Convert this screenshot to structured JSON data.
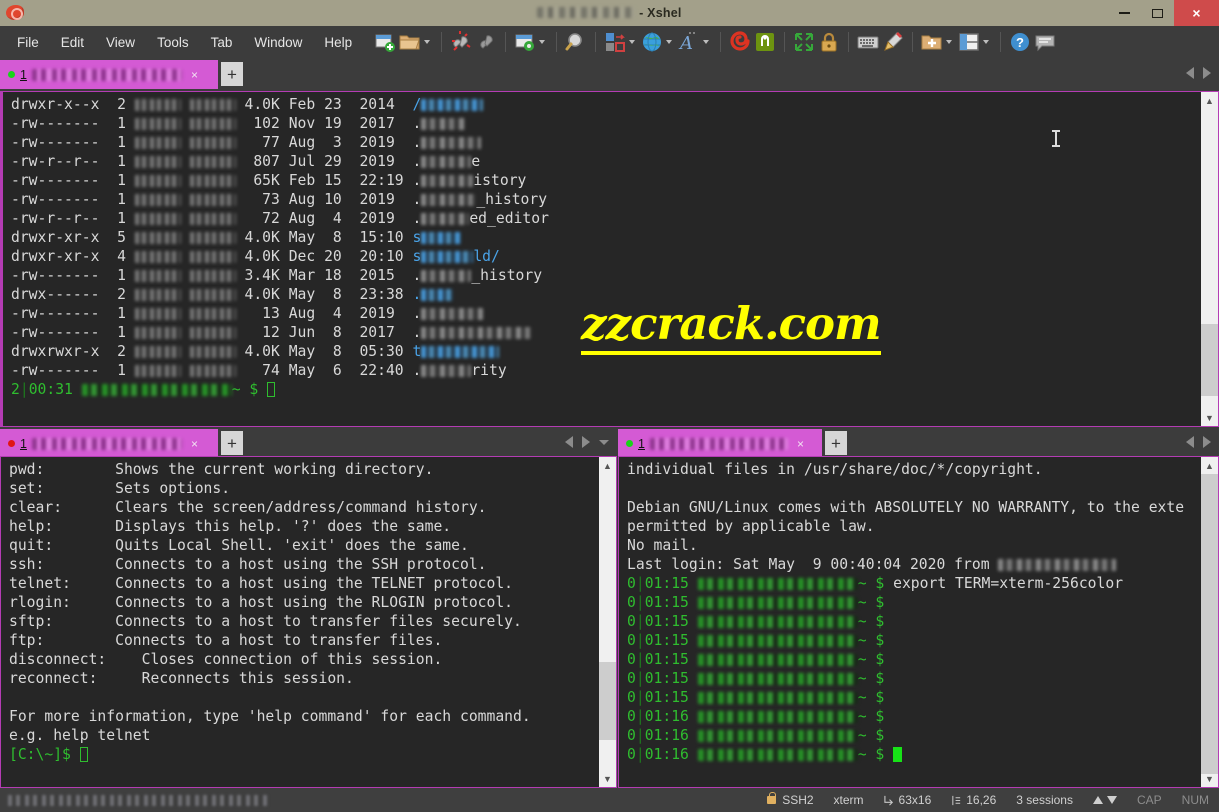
{
  "window": {
    "title_suffix": "- Xshel",
    "title_blurred": true,
    "minimize_label": "—",
    "maximize_label": "□",
    "close_label": "×",
    "app_icon": "snail-icon"
  },
  "menu": {
    "items": [
      "File",
      "Edit",
      "View",
      "Tools",
      "Tab",
      "Window",
      "Help"
    ]
  },
  "toolbar": {
    "items": [
      {
        "name": "new-session-icon",
        "caret": false
      },
      {
        "name": "open-session-icon",
        "caret": true
      },
      {
        "name": "disconnect-icon",
        "caret": false
      },
      {
        "name": "connect-link-icon",
        "caret": false
      },
      {
        "name": "session-properties-icon",
        "caret": true
      },
      {
        "name": "find-icon",
        "caret": false
      },
      {
        "name": "layout-arrange-icon",
        "caret": true
      },
      {
        "name": "globe-icon",
        "caret": true
      },
      {
        "name": "font-icon",
        "caret": true
      },
      {
        "name": "xshell-logo-icon",
        "caret": false
      },
      {
        "name": "nethelper-icon",
        "caret": false
      },
      {
        "name": "fullscreen-icon",
        "caret": false
      },
      {
        "name": "lock-icon",
        "caret": false
      },
      {
        "name": "keyboard-icon",
        "caret": false
      },
      {
        "name": "highlight-icon",
        "caret": false
      },
      {
        "name": "add-folder-icon",
        "caret": true
      },
      {
        "name": "split-layout-icon",
        "caret": true
      },
      {
        "name": "help-icon",
        "caret": false
      },
      {
        "name": "feedback-icon",
        "caret": false
      }
    ]
  },
  "panes": {
    "top": {
      "tab": {
        "status_dot": "green",
        "number": "1",
        "label_blurred": true,
        "close_label": "×",
        "add_label": "+"
      },
      "listing_columns": [
        "perms",
        "links",
        "owner",
        "group",
        "size",
        "month",
        "day",
        "time",
        "name"
      ],
      "listing": [
        {
          "perms": "drwxr-x--x",
          "links": "2",
          "size": "4.0K",
          "month": "Feb",
          "day": "23",
          "time": "2014",
          "name_visible": "/",
          "name_color": "blue",
          "blur_w": 62
        },
        {
          "perms": "-rw-------",
          "links": "1",
          "size": "102",
          "month": "Nov",
          "day": "19",
          "time": "2017",
          "name_visible": ".",
          "name_color": "grey",
          "blur_w": 44
        },
        {
          "perms": "-rw-------",
          "links": "1",
          "size": "77",
          "month": "Aug",
          "day": "3",
          "time": "2019",
          "name_visible": ".",
          "name_color": "grey",
          "blur_w": 60
        },
        {
          "perms": "-rw-r--r--",
          "links": "1",
          "size": "807",
          "month": "Jul",
          "day": "29",
          "time": "2019",
          "name_visible": ".",
          "name_suffix": "e",
          "name_color": "grey",
          "blur_w": 50
        },
        {
          "perms": "-rw-------",
          "links": "1",
          "size": "65K",
          "month": "Feb",
          "day": "15",
          "time": "22:19",
          "name_visible": ".",
          "name_suffix": "istory",
          "name_color": "grey",
          "blur_w": 52
        },
        {
          "perms": "-rw-------",
          "links": "1",
          "size": "73",
          "month": "Aug",
          "day": "10",
          "time": "2019",
          "name_visible": ".",
          "name_suffix": "_history",
          "name_color": "grey",
          "blur_w": 55
        },
        {
          "perms": "-rw-r--r--",
          "links": "1",
          "size": "72",
          "month": "Aug",
          "day": "4",
          "time": "2019",
          "name_visible": ".",
          "name_suffix": "ed_editor",
          "name_color": "grey",
          "blur_w": 48
        },
        {
          "perms": "drwxr-xr-x",
          "links": "5",
          "size": "4.0K",
          "month": "May",
          "day": "8",
          "time": "15:10",
          "name_visible": "s",
          "name_color": "blue",
          "blur_w": 40
        },
        {
          "perms": "drwxr-xr-x",
          "links": "4",
          "size": "4.0K",
          "month": "Dec",
          "day": "20",
          "time": "20:10",
          "name_visible": "s",
          "name_suffix": "ld/",
          "name_color": "blue",
          "blur_w": 52
        },
        {
          "perms": "-rw-------",
          "links": "1",
          "size": "3.4K",
          "month": "Mar",
          "day": "18",
          "time": "2015",
          "name_visible": ".",
          "name_suffix": "_history",
          "name_color": "grey",
          "blur_w": 50
        },
        {
          "perms": "drwx------",
          "links": "2",
          "size": "4.0K",
          "month": "May",
          "day": "8",
          "time": "23:38",
          "name_visible": ".",
          "name_color": "blue",
          "blur_w": 32
        },
        {
          "perms": "-rw-------",
          "links": "1",
          "size": "13",
          "month": "Aug",
          "day": "4",
          "time": "2019",
          "name_visible": ".",
          "name_color": "grey",
          "blur_w": 62
        },
        {
          "perms": "-rw-------",
          "links": "1",
          "size": "12",
          "month": "Jun",
          "day": "8",
          "time": "2017",
          "name_visible": ".",
          "name_color": "grey",
          "blur_w": 110
        },
        {
          "perms": "drwxrwxr-x",
          "links": "2",
          "size": "4.0K",
          "month": "May",
          "day": "8",
          "time": "05:30",
          "name_visible": "t",
          "name_color": "blue",
          "blur_w": 78
        },
        {
          "perms": "-rw-------",
          "links": "1",
          "size": "74",
          "month": "May",
          "day": "6",
          "time": "22:40",
          "name_visible": ".",
          "name_suffix": "rity",
          "name_color": "grey",
          "blur_w": 50
        }
      ],
      "prompt": {
        "exit_code": "2",
        "separator": "|",
        "clock": "00:31",
        "host_blurred": true,
        "path": "~",
        "symbol": "$"
      },
      "watermark": "zzcrack.com",
      "watermark_color": "#ffff00"
    },
    "bottom_left": {
      "tab": {
        "status_dot": "red",
        "number": "1",
        "label_blurred": true,
        "close_label": "×",
        "add_label": "+"
      },
      "lines": [
        "pwd:        Shows the current working directory.",
        "set:        Sets options.",
        "clear:      Clears the screen/address/command history.",
        "help:       Displays this help. '?' does the same.",
        "quit:       Quits Local Shell. 'exit' does the same.",
        "ssh:        Connects to a host using the SSH protocol.",
        "telnet:     Connects to a host using the TELNET protocol.",
        "rlogin:     Connects to a host using the RLOGIN protocol.",
        "sftp:       Connects to a host to transfer files securely.",
        "ftp:        Connects to a host to transfer files.",
        "disconnect:    Closes connection of this session.",
        "reconnect:     Reconnects this session.",
        "",
        "For more information, type 'help command' for each command.",
        "e.g. help telnet"
      ],
      "prompt": "[C:\\~]$"
    },
    "bottom_right": {
      "tab": {
        "status_dot": "green",
        "number": "1",
        "label_blurred": true,
        "close_label": "×",
        "add_label": "+"
      },
      "lines": [
        "individual files in /usr/share/doc/*/copyright.",
        "",
        "Debian GNU/Linux comes with ABSOLUTELY NO WARRANTY, to the exte",
        "permitted by applicable law.",
        "No mail."
      ],
      "last_login": "Last login: Sat May  9 00:40:04 2020 from",
      "prompt_rows": [
        {
          "code": "0",
          "clock": "01:15",
          "path": "~",
          "symbol": "$",
          "command": "export TERM=xterm-256color",
          "cursor": false
        },
        {
          "code": "0",
          "clock": "01:15",
          "path": "~",
          "symbol": "$",
          "command": "",
          "cursor": false
        },
        {
          "code": "0",
          "clock": "01:15",
          "path": "~",
          "symbol": "$",
          "command": "",
          "cursor": false
        },
        {
          "code": "0",
          "clock": "01:15",
          "path": "~",
          "symbol": "$",
          "command": "",
          "cursor": false
        },
        {
          "code": "0",
          "clock": "01:15",
          "path": "~",
          "symbol": "$",
          "command": "",
          "cursor": false
        },
        {
          "code": "0",
          "clock": "01:15",
          "path": "~",
          "symbol": "$",
          "command": "",
          "cursor": false
        },
        {
          "code": "0",
          "clock": "01:15",
          "path": "~",
          "symbol": "$",
          "command": "",
          "cursor": false
        },
        {
          "code": "0",
          "clock": "01:16",
          "path": "~",
          "symbol": "$",
          "command": "",
          "cursor": false
        },
        {
          "code": "0",
          "clock": "01:16",
          "path": "~",
          "symbol": "$",
          "command": "",
          "cursor": false
        },
        {
          "code": "0",
          "clock": "01:16",
          "path": "~",
          "symbol": "$",
          "command": "",
          "cursor": true
        }
      ]
    }
  },
  "statusbar": {
    "left_blurred": true,
    "protocol": "SSH2",
    "terminal_type": "xterm",
    "size": "63x16",
    "cursor_pos": "16,26",
    "sessions": "3 sessions",
    "cap": "CAP",
    "num": "NUM"
  }
}
